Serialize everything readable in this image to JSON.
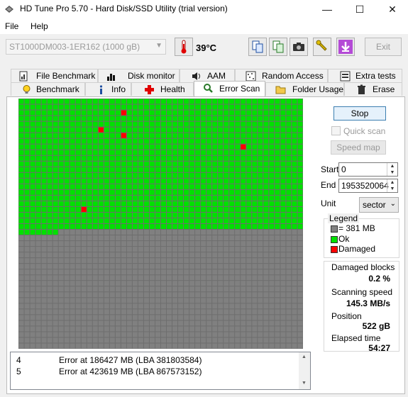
{
  "window": {
    "title": "HD Tune Pro 5.70 - Hard Disk/SSD Utility (trial version)"
  },
  "menu": [
    "File",
    "Help"
  ],
  "toolbar": {
    "drive": "ST1000DM003-1ER162 (1000 gB)",
    "temperature": "39°C",
    "exit_label": "Exit"
  },
  "tabs_top": [
    "File Benchmark",
    "Disk monitor",
    "AAM",
    "Random Access",
    "Extra tests"
  ],
  "tabs_bottom": [
    "Benchmark",
    "Info",
    "Health",
    "Error Scan",
    "Folder Usage",
    "Erase"
  ],
  "active_tab": "Error Scan",
  "scan": {
    "stop_label": "Stop",
    "quick_scan_label": "Quick scan",
    "speed_map_label": "Speed map",
    "start_label": "Start",
    "start_value": "0",
    "end_label": "End",
    "end_value": "1953520064",
    "unit_label": "Unit",
    "unit_value": "sector"
  },
  "legend": {
    "title": "Legend",
    "items": [
      {
        "label": "= 381 MB",
        "color": "#808080"
      },
      {
        "label": "Ok",
        "color": "#00e000"
      },
      {
        "label": "Damaged",
        "color": "#ff0000"
      }
    ]
  },
  "stats": {
    "damaged_label": "Damaged blocks",
    "damaged_value": "0.2 %",
    "speed_label": "Scanning speed",
    "speed_value": "145.3 MB/s",
    "position_label": "Position",
    "position_value": "522 gB",
    "elapsed_label": "Elapsed time",
    "elapsed_value": "54:27"
  },
  "log": [
    {
      "num": "4",
      "text": "Error at 186427 MB (LBA 381803584)"
    },
    {
      "num": "5",
      "text": "Error at 423619 MB (LBA 867573152)"
    }
  ],
  "block_map": {
    "columns": 50,
    "rows": 44,
    "ok_color": "#00e000",
    "unscanned_color": "#808080",
    "damaged_color": "#ff0000",
    "scanned_full_rows": 23,
    "scanned_partial_cells": 7,
    "damaged_cells": [
      [
        18,
        2
      ],
      [
        14,
        5
      ],
      [
        18,
        6
      ],
      [
        39,
        8
      ],
      [
        11,
        19
      ]
    ]
  }
}
